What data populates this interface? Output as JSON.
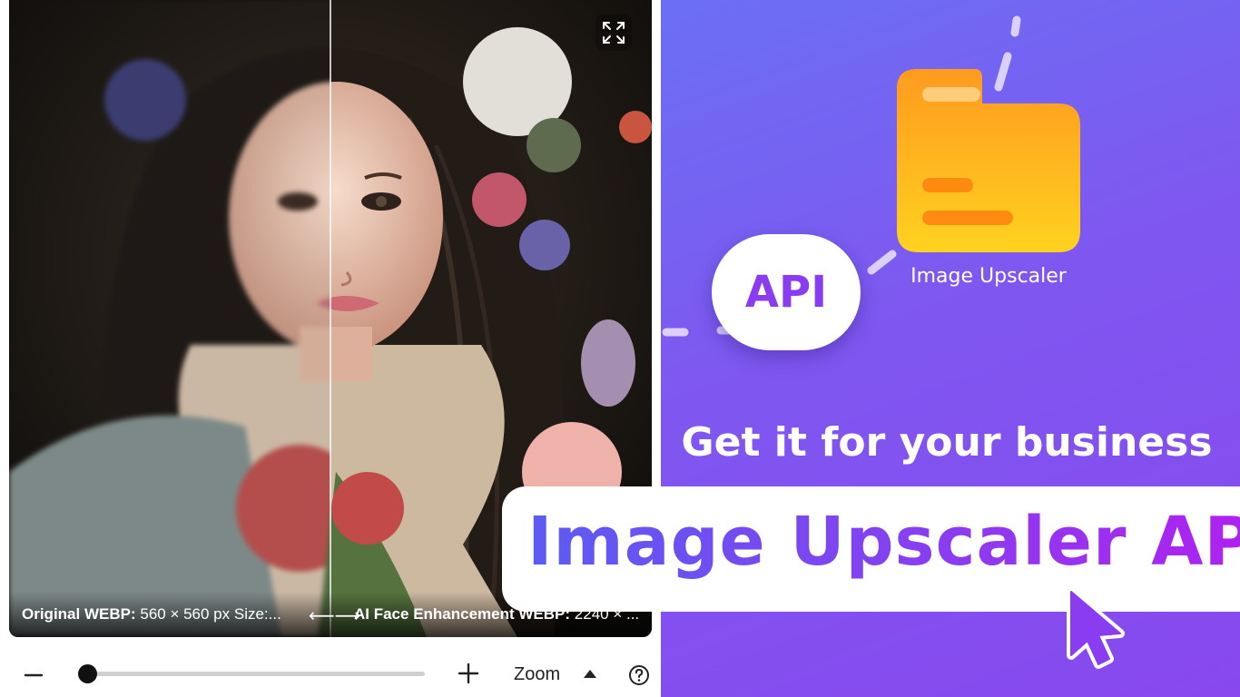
{
  "viewer": {
    "original_label": "Original WEBP:",
    "original_value": "560 × 560 px   Size:...",
    "enhanced_label": "AI Face Enhancement WEBP:",
    "enhanced_value": "2240 × ...",
    "drag_arrows": "⟵⟶",
    "expand_icon": "expand-icon"
  },
  "toolbar": {
    "zoom_label": "Zoom",
    "zoom_level_fraction": 0.02,
    "minus_icon": "minus-icon",
    "plus_icon": "plus-icon",
    "caret_icon": "caret-up-icon",
    "help_icon": "help-icon"
  },
  "promo": {
    "api_label": "API",
    "folder_label": "Image Upscaler",
    "headline": "Get it for your business",
    "banner_title": "Image Upscaler API",
    "colors": {
      "gradient_start": "#6b6ff5",
      "gradient_end": "#8848ee",
      "accent_purple": "#8a3df0",
      "folder_orange": "#ff9a1f",
      "folder_yellow": "#ffd21f"
    }
  }
}
